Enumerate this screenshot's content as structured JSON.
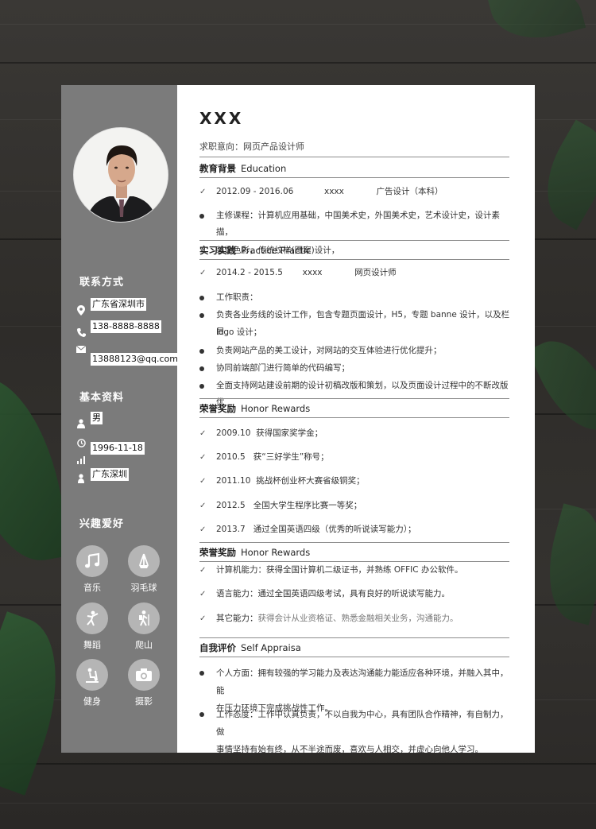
{
  "resume": {
    "name": "XXX",
    "intent": "求职意向：网页产品设计师"
  },
  "sidebar": {
    "contact_heading": "联系方式",
    "address": "广东省深圳市",
    "phone": "138-8888-8888",
    "email": "13888123@qq.com",
    "basic_heading": "基本资料",
    "gender": "男",
    "birthday": "1996-11-18",
    "hometown": "广东深圳",
    "hobby_heading": "兴趣爱好",
    "hobbies": [
      {
        "label": "音乐",
        "icon": "music-icon"
      },
      {
        "label": "羽毛球",
        "icon": "badminton-icon"
      },
      {
        "label": "舞蹈",
        "icon": "dance-icon"
      },
      {
        "label": "爬山",
        "icon": "hiking-icon"
      },
      {
        "label": "健身",
        "icon": "fitness-icon"
      },
      {
        "label": "摄影",
        "icon": "camera-icon"
      }
    ]
  },
  "education": {
    "title_cn": "教育背景",
    "title_en": "Education",
    "period": "2012.09 - 2016.06",
    "school": "xxxx",
    "major": "广告设计（本科）",
    "courses_line1": "主修课程：计算机应用基础，中国美术史，外国美术史，艺术设计史，设计素描，",
    "courses_line2": "装饰色彩，传统纹样(图案)设计，"
  },
  "practice": {
    "title_cn": "实习实践",
    "title_en": "Practice Practic",
    "period": "2014.2 - 2015.5",
    "company": "xxxx",
    "role": "网页设计师",
    "items": [
      "工作职责：",
      "负责各业务线的设计工作，包含专题页面设计，H5，专题 banne 设计，以及栏目",
      "logo 设计；",
      "负责网站产品的美工设计，对网站的交互体验进行优化提升；",
      "协同前端部门进行简单的代码编写；",
      "全面支持网站建设前期的设计初稿改版和策划，以及页面设计过程中的不断改版优"
    ]
  },
  "honors": {
    "title_cn": "荣誉奖励",
    "title_en": "Honor Rewards",
    "items": [
      "2009.10  获得国家奖学金；",
      "2010.5   获“三好学生”称号；",
      "2011.10  挑战杯创业杯大赛省级铜奖；",
      "2012.5   全国大学生程序比赛一等奖；",
      "2013.7   通过全国英语四级（优秀的听说读写能力）；"
    ]
  },
  "skills": {
    "title_cn": "荣誉奖励",
    "title_en": "Honor Rewards",
    "items": [
      {
        "head": "计算机能力：",
        "body": "获得全国计算机二级证书，并熟练 OFFIC 办公软件。"
      },
      {
        "head": "语言能力：",
        "body": "通过全国英语四级考试，具有良好的听说读写能力。"
      },
      {
        "head": "其它能力：",
        "body": "获得会计从业资格证、熟悉金融相关业务，沟通能力。"
      }
    ]
  },
  "self": {
    "title_cn": "自我评价",
    "title_en": "Self Appraisa",
    "p1_line1": "个人方面：拥有较强的学习能力及表达沟通能力能适应各种环境，并融入其中，能",
    "p1_line2": "在压力环境下完成挑战性工作。",
    "p2_line1": "工作态度：工作中认真负责，不以自我为中心，具有团队合作精神，有自制力，做",
    "p2_line2": "事情坚持有始有终，从不半途而废，喜欢与人相交，并虚心向他人学习。"
  },
  "colors": {
    "sidebar": "#7b7b7b",
    "paper": "#ffffff",
    "hobby_circle": "#b5b5b5"
  }
}
